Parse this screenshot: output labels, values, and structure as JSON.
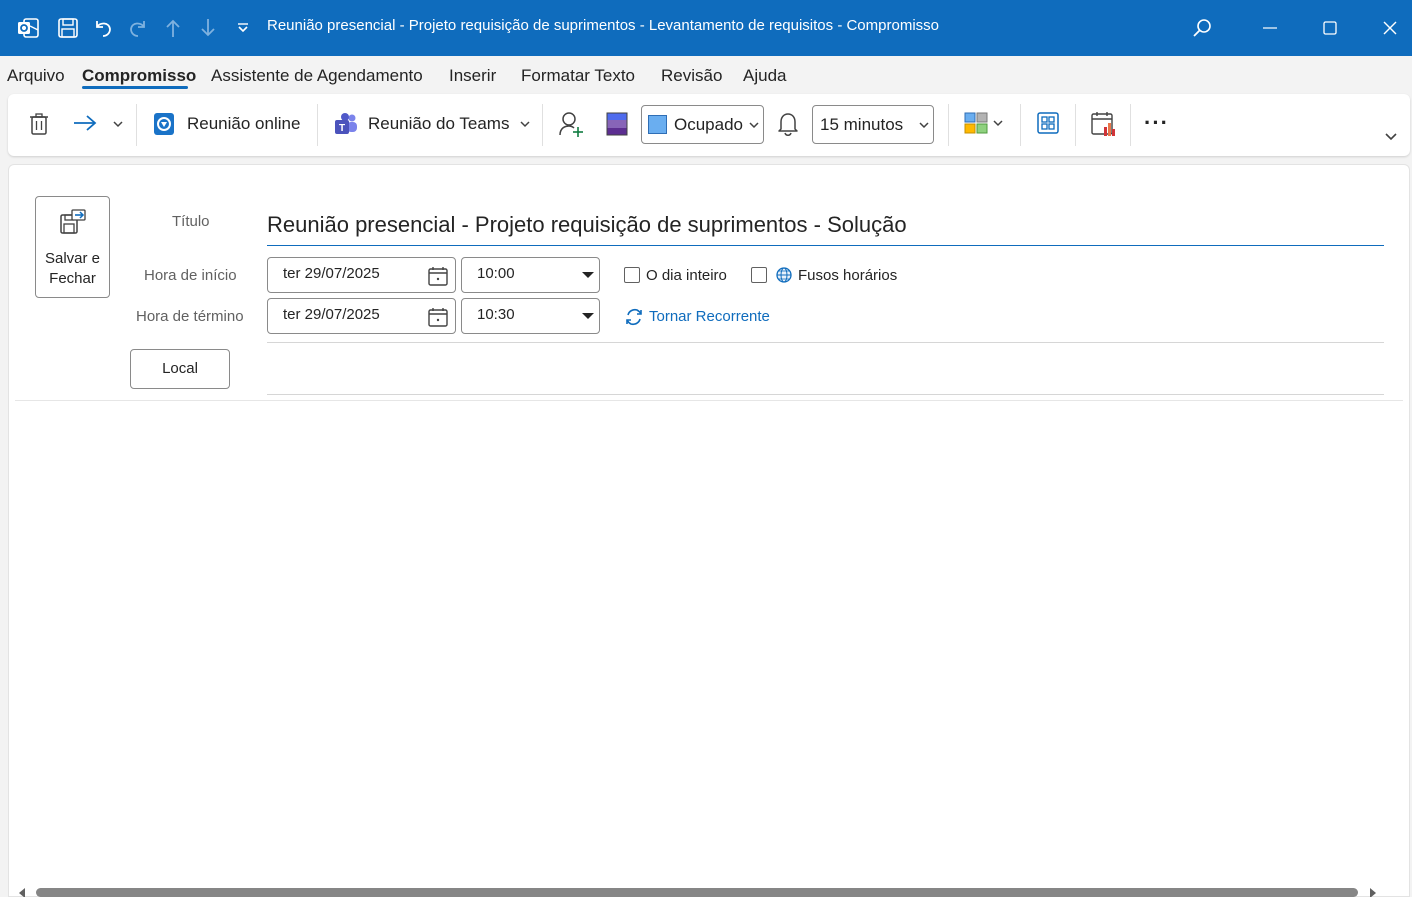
{
  "window": {
    "title": "Reunião presencial - Projeto requisição de suprimentos - Levantamento de requisitos  -  Compromisso",
    "accent": "#0f6cbd"
  },
  "menu": {
    "tabs": [
      "Arquivo",
      "Compromisso",
      "Assistente de Agendamento",
      "Inserir",
      "Formatar Texto",
      "Revisão",
      "Ajuda"
    ],
    "active": "Compromisso"
  },
  "ribbon": {
    "online_meeting": "Reunião online",
    "teams_meeting": "Reunião do Teams",
    "show_as": "Ocupado",
    "reminder": "15 minutos",
    "more": "···"
  },
  "form": {
    "save_close_line1": "Salvar e",
    "save_close_line2": "Fechar",
    "title_label": "Título",
    "title_value": "Reunião presencial - Projeto requisição de suprimentos - Solução",
    "start_label": "Hora de início",
    "end_label": "Hora de término",
    "start_date": "ter 29/07/2025",
    "start_time": "10:00",
    "end_date": "ter 29/07/2025",
    "end_time": "10:30",
    "all_day_label": "O dia inteiro",
    "all_day_checked": false,
    "timezones_label": "Fusos horários",
    "timezones_checked": false,
    "recurrence_label": "Tornar Recorrente",
    "location_button": "Local",
    "location_value": ""
  }
}
